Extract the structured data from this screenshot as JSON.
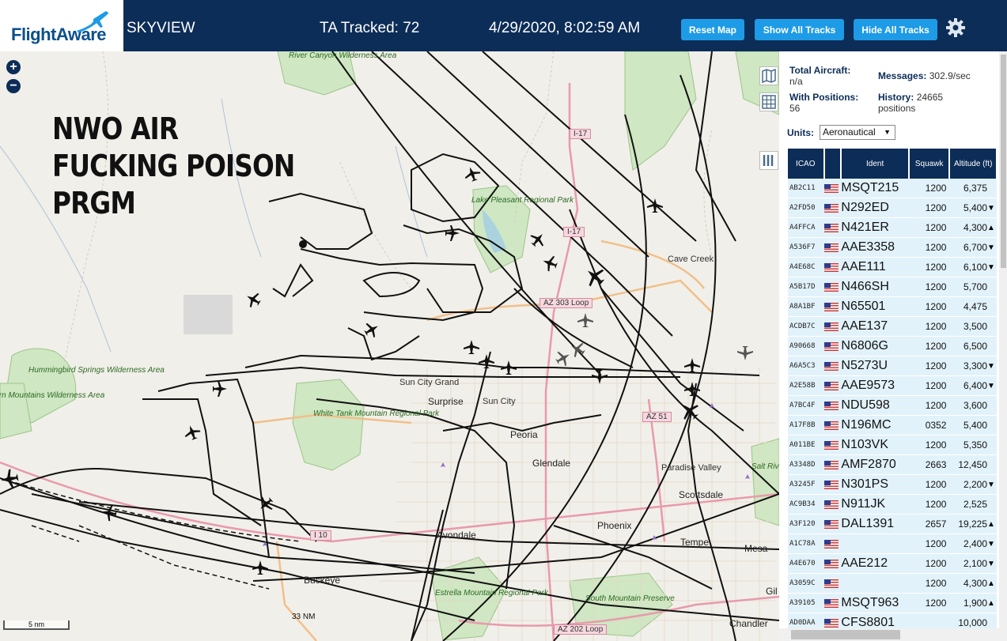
{
  "header": {
    "brand": "FlightAware",
    "app_name": "SKYVIEW",
    "tracked": "TA Tracked: 72",
    "datetime": "4/29/2020, 8:02:59 AM",
    "buttons": {
      "reset": "Reset Map",
      "show": "Show All Tracks",
      "hide": "Hide All Tracks"
    },
    "colors": {
      "bar": "#0c2d57",
      "button": "#1e9be6"
    }
  },
  "map": {
    "overlay_text": [
      "NWO AIR",
      "FUCKING POISON",
      "PRGM"
    ],
    "zoom_in": "+",
    "zoom_out": "−",
    "scale_label": "5 nm",
    "range_label": "33 NM",
    "places": {
      "river_canyon": "River Canyon Wilderness Area",
      "lake_pleasant": "Lake Pleasant Regional Park",
      "cave_creek": "Cave Creek",
      "hummingbird": "Hummingbird Springs Wilderness Area",
      "horn": "Horn Mountains Wilderness Area",
      "white_tank": "White Tank Mountain Regional Park",
      "sun_city_grand": "Sun City Grand",
      "surprise": "Surprise",
      "sun_city": "Sun City",
      "peoria": "Peoria",
      "glendale": "Glendale",
      "paradise_valley": "Paradise Valley",
      "scottsdale": "Scottsdale",
      "phoenix": "Phoenix",
      "tempe": "Tempe",
      "mesa": "Mesa",
      "avondale": "Avondale",
      "buckeye": "Buckeye",
      "estrella": "Estrella Mountain Regional Park",
      "south_mountain": "South Mountain Preserve",
      "salt_river": "Salt River Pima-Maricopa Indian Community",
      "chandler": "Chandler",
      "gilbert": "Gil"
    },
    "roads": {
      "i17a": "I-17",
      "i17b": "I-17",
      "az303": "AZ 303 Loop",
      "az51": "AZ 51",
      "i10": "I 10",
      "az202": "AZ 202 Loop"
    }
  },
  "panel": {
    "total_aircraft_label": "Total Aircraft:",
    "total_aircraft_value": "n/a",
    "messages_label": "Messages:",
    "messages_value": "302.9/sec",
    "positions_label": "With Positions:",
    "positions_value": "56",
    "history_label": "History:",
    "history_value": "24665 positions",
    "units_label": "Units:",
    "units_value": "Aeronautical",
    "columns": {
      "icao": "ICAO",
      "ident": "Ident",
      "squawk": "Squawk",
      "altitude": "Altitude (ft)"
    },
    "rows": [
      {
        "icao": "AB2C11",
        "ident": "MSQT215",
        "squawk": "1200",
        "alt": "6,375",
        "trend": ""
      },
      {
        "icao": "A2FD50",
        "ident": "N292ED",
        "squawk": "1200",
        "alt": "5,400",
        "trend": "▼"
      },
      {
        "icao": "A4FFCA",
        "ident": "N421ER",
        "squawk": "1200",
        "alt": "4,300",
        "trend": "▲"
      },
      {
        "icao": "A536F7",
        "ident": "AAE3358",
        "squawk": "1200",
        "alt": "6,700",
        "trend": "▼"
      },
      {
        "icao": "A4E68C",
        "ident": "AAE111",
        "squawk": "1200",
        "alt": "6,100",
        "trend": "▼"
      },
      {
        "icao": "A5B17D",
        "ident": "N466SH",
        "squawk": "1200",
        "alt": "5,700",
        "trend": ""
      },
      {
        "icao": "A8A1BF",
        "ident": "N65501",
        "squawk": "1200",
        "alt": "4,475",
        "trend": ""
      },
      {
        "icao": "ACDB7C",
        "ident": "AAE137",
        "squawk": "1200",
        "alt": "3,500",
        "trend": ""
      },
      {
        "icao": "A90668",
        "ident": "N6806G",
        "squawk": "1200",
        "alt": "6,500",
        "trend": ""
      },
      {
        "icao": "A6A5C3",
        "ident": "N5273U",
        "squawk": "1200",
        "alt": "3,300",
        "trend": "▼"
      },
      {
        "icao": "A2E58B",
        "ident": "AAE9573",
        "squawk": "1200",
        "alt": "6,400",
        "trend": "▼"
      },
      {
        "icao": "A7BC4F",
        "ident": "NDU598",
        "squawk": "1200",
        "alt": "3,600",
        "trend": ""
      },
      {
        "icao": "A17F8B",
        "ident": "N196MC",
        "squawk": "0352",
        "alt": "5,400",
        "trend": ""
      },
      {
        "icao": "A011BE",
        "ident": "N103VK",
        "squawk": "1200",
        "alt": "5,350",
        "trend": ""
      },
      {
        "icao": "A3348D",
        "ident": "AMF2870",
        "squawk": "2663",
        "alt": "12,450",
        "trend": ""
      },
      {
        "icao": "A3245F",
        "ident": "N301PS",
        "squawk": "1200",
        "alt": "2,200",
        "trend": "▼"
      },
      {
        "icao": "AC9B34",
        "ident": "N911JK",
        "squawk": "1200",
        "alt": "2,525",
        "trend": ""
      },
      {
        "icao": "A3F120",
        "ident": "DAL1391",
        "squawk": "2657",
        "alt": "19,225",
        "trend": "▲"
      },
      {
        "icao": "A1C78A",
        "ident": "",
        "squawk": "1200",
        "alt": "2,400",
        "trend": "▼"
      },
      {
        "icao": "A4E670",
        "ident": "AAE212",
        "squawk": "1200",
        "alt": "2,100",
        "trend": "▼"
      },
      {
        "icao": "A3059C",
        "ident": "",
        "squawk": "1200",
        "alt": "4,300",
        "trend": "▲"
      },
      {
        "icao": "A39105",
        "ident": "MSQT963",
        "squawk": "1200",
        "alt": "1,900",
        "trend": "▲"
      },
      {
        "icao": "AD0DAA",
        "ident": "CFS8801",
        "squawk": "",
        "alt": "10,000",
        "trend": ""
      }
    ]
  }
}
